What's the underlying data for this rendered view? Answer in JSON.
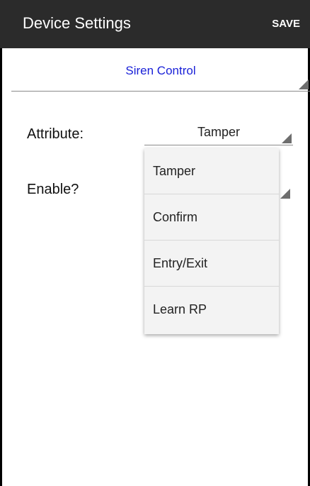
{
  "appbar": {
    "title": "Device Settings",
    "save_label": "SAVE"
  },
  "device_select": {
    "value": "Siren Control"
  },
  "form": {
    "attribute_label": "Attribute:",
    "attribute_value": "Tamper",
    "enable_label": "Enable?"
  },
  "dropdown": {
    "options": [
      "Tamper",
      "Confirm",
      "Entry/Exit",
      "Learn RP"
    ]
  },
  "colors": {
    "appbar_bg": "#2b2b2b",
    "link_blue": "#1a21d8"
  }
}
